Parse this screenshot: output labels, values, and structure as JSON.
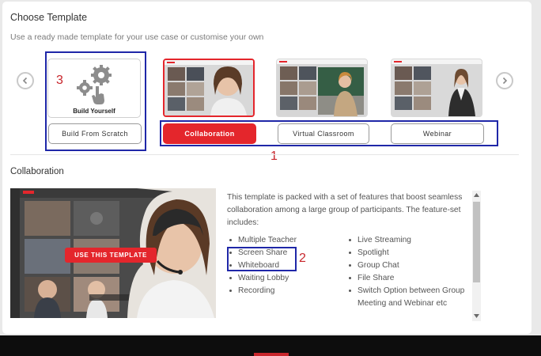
{
  "header": {
    "title": "Choose Template",
    "subtitle": "Use a ready made template for your use case or customise your own"
  },
  "templates": {
    "build_yourself_label": "Build Yourself",
    "buttons": [
      "Build From Scratch",
      "Collaboration",
      "Virtual Classroom",
      "Webinar"
    ],
    "selected": "Collaboration"
  },
  "annotations": {
    "one": "1",
    "two": "2",
    "three": "3"
  },
  "details": {
    "title": "Collaboration",
    "cta": "USE THIS TEMPLATE",
    "description": "This template is packed with a set of features that boost seamless collaboration among a large group of participants. The feature-set includes:",
    "features_left": [
      "Multiple Teacher",
      "Screen Share",
      "Whiteboard",
      "Waiting Lobby",
      "Recording"
    ],
    "features_right": [
      "Live Streaming",
      "Spotlight",
      "Group Chat",
      "File Share",
      "Switch Option between Group Meeting and Webinar etc"
    ]
  },
  "colors": {
    "accent": "#e4262c",
    "annotation_box": "#1f27a8",
    "annotation_text": "#c8262c"
  },
  "icons": {
    "prev": "chevron-left-icon",
    "next": "chevron-right-icon",
    "build": "gear-hand-icon"
  }
}
